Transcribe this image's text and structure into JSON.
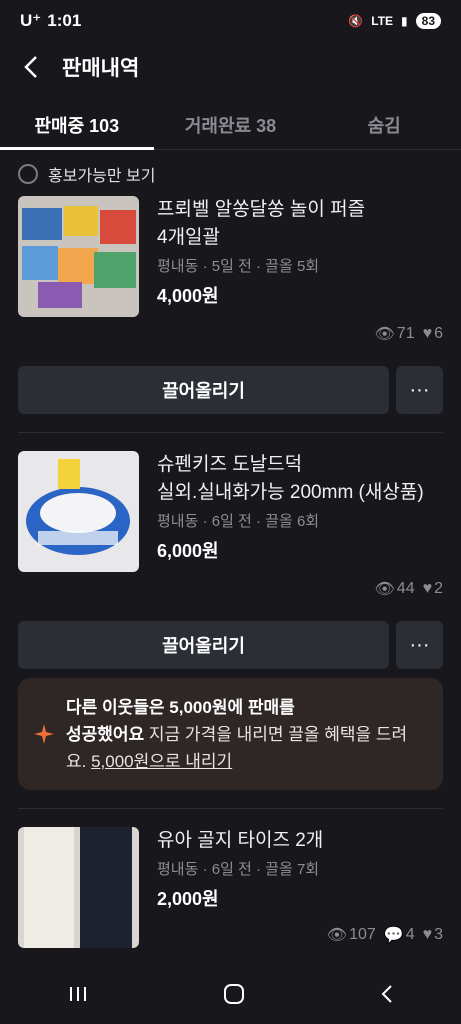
{
  "status": {
    "time": "1:01",
    "carrier": "U⁺",
    "network": "LTE",
    "battery": "83"
  },
  "header": {
    "title": "판매내역"
  },
  "tabs": [
    {
      "label": "판매중 103"
    },
    {
      "label": "거래완료 38"
    },
    {
      "label": "숨김"
    }
  ],
  "filter": {
    "label": "홍보가능만 보기"
  },
  "items": [
    {
      "name_line1": "프뢰벨 알쏭달쏭 놀이 퍼즐",
      "name_line2": "4개일괄",
      "meta": "평내동 · 5일 전 · 끌올 5회",
      "price": "4,000원",
      "views": "71",
      "likes": "6",
      "bump": "끌어올리기",
      "more": "···"
    },
    {
      "name_line1": "슈펜키즈 도날드덕",
      "name_line2": "실외.실내화가능 200mm (새상품)",
      "meta": "평내동 · 6일 전 · 끌올 6회",
      "price": "6,000원",
      "views": "44",
      "likes": "2",
      "bump": "끌어올리기",
      "more": "···"
    },
    {
      "name_line1": "유아 골지 타이즈 2개",
      "meta": "평내동 · 6일 전 · 끌올 7회",
      "price": "2,000원",
      "views": "107",
      "chats": "4",
      "likes": "3"
    }
  ],
  "tip": {
    "bold1": "다른 이웃들은 5,000원에 판매를",
    "bold2": "성공했어요",
    "text": " 지금 가격을 내리면 끌올 혜택을 드려요. ",
    "link": "5,000원으로 내리기"
  },
  "colors": {
    "background": "#17171c",
    "button": "#2b2e35",
    "tip_bg": "#2f2626",
    "star": "#f0703a"
  }
}
